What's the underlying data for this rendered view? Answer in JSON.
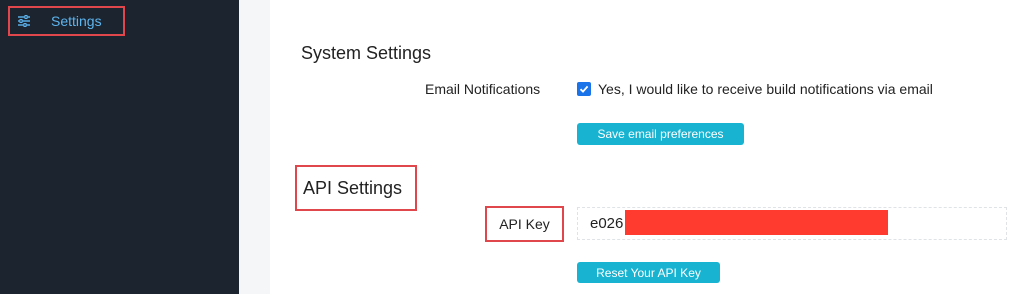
{
  "sidebar": {
    "items": [
      {
        "label": "Settings",
        "icon": "sliders-icon"
      }
    ]
  },
  "system_settings": {
    "title": "System Settings",
    "email_notifications": {
      "label": "Email Notifications",
      "checkbox_text": "Yes, I would like to receive build notifications via email",
      "checked": true
    },
    "save_button_label": "Save email preferences"
  },
  "api_settings": {
    "title": "API Settings",
    "api_key_label": "API Key",
    "api_key_visible_prefix": "e026",
    "reset_button_label": "Reset Your API Key"
  },
  "colors": {
    "sidebar_bg": "#1c2430",
    "sidebar_link": "#5db5ef",
    "button_bg": "#17b3d1",
    "highlight_border": "#e0474c",
    "redaction": "#ff3b30",
    "checkbox": "#1a73e8"
  }
}
